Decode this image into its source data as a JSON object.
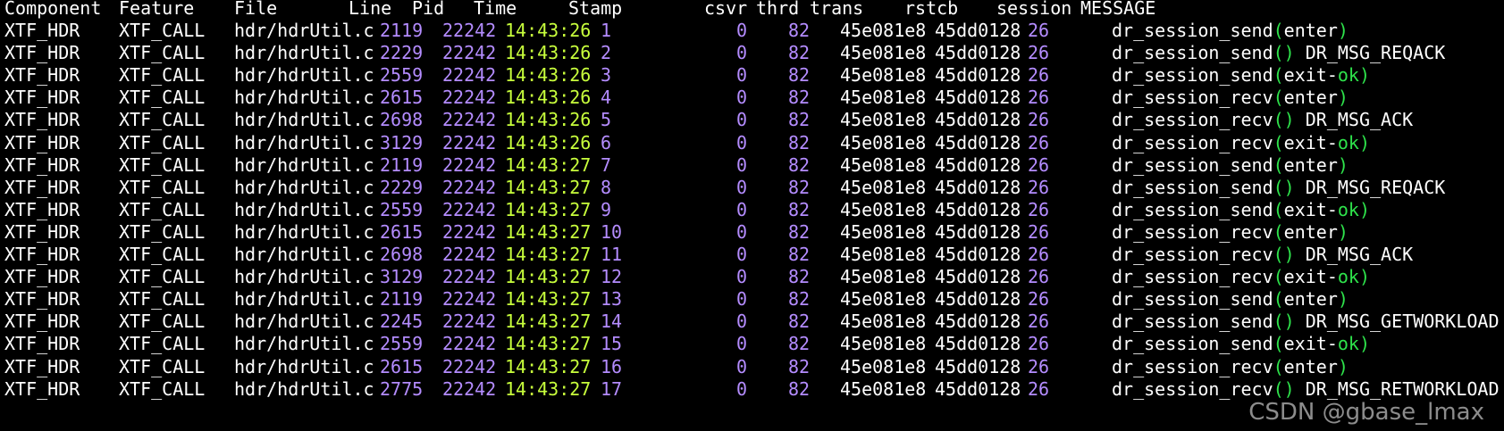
{
  "columns": {
    "component": "Component",
    "feature": "Feature",
    "file": "File",
    "line": "Line",
    "pid": "Pid",
    "time": "Time",
    "stamp": "Stamp",
    "csvr": "csvr",
    "thrd": "thrd",
    "trans": "trans",
    "rstcb": "rstcb",
    "session": "session",
    "message": "MESSAGE"
  },
  "rows": [
    {
      "component": "XTF_HDR",
      "feature": "XTF_CALL",
      "file": "hdr/hdrUtil.c",
      "line": "2119",
      "pid": "22242",
      "time": "14:43:26",
      "stamp": "1",
      "csvr": "0",
      "thrd": "82",
      "trans": "45e081e8",
      "rstcb": "45dd0128",
      "session": "26",
      "func": "dr_session_send",
      "open": "(",
      "arg": "enter",
      "arg_ok": "",
      "close": ")",
      "tail": ""
    },
    {
      "component": "XTF_HDR",
      "feature": "XTF_CALL",
      "file": "hdr/hdrUtil.c",
      "line": "2229",
      "pid": "22242",
      "time": "14:43:26",
      "stamp": "2",
      "csvr": "0",
      "thrd": "82",
      "trans": "45e081e8",
      "rstcb": "45dd0128",
      "session": "26",
      "func": "dr_session_send",
      "open": "(",
      "arg": "",
      "arg_ok": "",
      "close": ")",
      "tail": " DR_MSG_REQACK"
    },
    {
      "component": "XTF_HDR",
      "feature": "XTF_CALL",
      "file": "hdr/hdrUtil.c",
      "line": "2559",
      "pid": "22242",
      "time": "14:43:26",
      "stamp": "3",
      "csvr": "0",
      "thrd": "82",
      "trans": "45e081e8",
      "rstcb": "45dd0128",
      "session": "26",
      "func": "dr_session_send",
      "open": "(",
      "arg": "exit-",
      "arg_ok": "ok",
      "close": ")",
      "tail": ""
    },
    {
      "component": "XTF_HDR",
      "feature": "XTF_CALL",
      "file": "hdr/hdrUtil.c",
      "line": "2615",
      "pid": "22242",
      "time": "14:43:26",
      "stamp": "4",
      "csvr": "0",
      "thrd": "82",
      "trans": "45e081e8",
      "rstcb": "45dd0128",
      "session": "26",
      "func": "dr_session_recv",
      "open": "(",
      "arg": "enter",
      "arg_ok": "",
      "close": ")",
      "tail": ""
    },
    {
      "component": "XTF_HDR",
      "feature": "XTF_CALL",
      "file": "hdr/hdrUtil.c",
      "line": "2698",
      "pid": "22242",
      "time": "14:43:26",
      "stamp": "5",
      "csvr": "0",
      "thrd": "82",
      "trans": "45e081e8",
      "rstcb": "45dd0128",
      "session": "26",
      "func": "dr_session_recv",
      "open": "(",
      "arg": "",
      "arg_ok": "",
      "close": ")",
      "tail": " DR_MSG_ACK"
    },
    {
      "component": "XTF_HDR",
      "feature": "XTF_CALL",
      "file": "hdr/hdrUtil.c",
      "line": "3129",
      "pid": "22242",
      "time": "14:43:26",
      "stamp": "6",
      "csvr": "0",
      "thrd": "82",
      "trans": "45e081e8",
      "rstcb": "45dd0128",
      "session": "26",
      "func": "dr_session_recv",
      "open": "(",
      "arg": "exit-",
      "arg_ok": "ok",
      "close": ")",
      "tail": ""
    },
    {
      "component": "XTF_HDR",
      "feature": "XTF_CALL",
      "file": "hdr/hdrUtil.c",
      "line": "2119",
      "pid": "22242",
      "time": "14:43:27",
      "stamp": "7",
      "csvr": "0",
      "thrd": "82",
      "trans": "45e081e8",
      "rstcb": "45dd0128",
      "session": "26",
      "func": "dr_session_send",
      "open": "(",
      "arg": "enter",
      "arg_ok": "",
      "close": ")",
      "tail": ""
    },
    {
      "component": "XTF_HDR",
      "feature": "XTF_CALL",
      "file": "hdr/hdrUtil.c",
      "line": "2229",
      "pid": "22242",
      "time": "14:43:27",
      "stamp": "8",
      "csvr": "0",
      "thrd": "82",
      "trans": "45e081e8",
      "rstcb": "45dd0128",
      "session": "26",
      "func": "dr_session_send",
      "open": "(",
      "arg": "",
      "arg_ok": "",
      "close": ")",
      "tail": " DR_MSG_REQACK"
    },
    {
      "component": "XTF_HDR",
      "feature": "XTF_CALL",
      "file": "hdr/hdrUtil.c",
      "line": "2559",
      "pid": "22242",
      "time": "14:43:27",
      "stamp": "9",
      "csvr": "0",
      "thrd": "82",
      "trans": "45e081e8",
      "rstcb": "45dd0128",
      "session": "26",
      "func": "dr_session_send",
      "open": "(",
      "arg": "exit-",
      "arg_ok": "ok",
      "close": ")",
      "tail": ""
    },
    {
      "component": "XTF_HDR",
      "feature": "XTF_CALL",
      "file": "hdr/hdrUtil.c",
      "line": "2615",
      "pid": "22242",
      "time": "14:43:27",
      "stamp": "10",
      "csvr": "0",
      "thrd": "82",
      "trans": "45e081e8",
      "rstcb": "45dd0128",
      "session": "26",
      "func": "dr_session_recv",
      "open": "(",
      "arg": "enter",
      "arg_ok": "",
      "close": ")",
      "tail": ""
    },
    {
      "component": "XTF_HDR",
      "feature": "XTF_CALL",
      "file": "hdr/hdrUtil.c",
      "line": "2698",
      "pid": "22242",
      "time": "14:43:27",
      "stamp": "11",
      "csvr": "0",
      "thrd": "82",
      "trans": "45e081e8",
      "rstcb": "45dd0128",
      "session": "26",
      "func": "dr_session_recv",
      "open": "(",
      "arg": "",
      "arg_ok": "",
      "close": ")",
      "tail": " DR_MSG_ACK"
    },
    {
      "component": "XTF_HDR",
      "feature": "XTF_CALL",
      "file": "hdr/hdrUtil.c",
      "line": "3129",
      "pid": "22242",
      "time": "14:43:27",
      "stamp": "12",
      "csvr": "0",
      "thrd": "82",
      "trans": "45e081e8",
      "rstcb": "45dd0128",
      "session": "26",
      "func": "dr_session_recv",
      "open": "(",
      "arg": "exit-",
      "arg_ok": "ok",
      "close": ")",
      "tail": ""
    },
    {
      "component": "XTF_HDR",
      "feature": "XTF_CALL",
      "file": "hdr/hdrUtil.c",
      "line": "2119",
      "pid": "22242",
      "time": "14:43:27",
      "stamp": "13",
      "csvr": "0",
      "thrd": "82",
      "trans": "45e081e8",
      "rstcb": "45dd0128",
      "session": "26",
      "func": "dr_session_send",
      "open": "(",
      "arg": "enter",
      "arg_ok": "",
      "close": ")",
      "tail": ""
    },
    {
      "component": "XTF_HDR",
      "feature": "XTF_CALL",
      "file": "hdr/hdrUtil.c",
      "line": "2245",
      "pid": "22242",
      "time": "14:43:27",
      "stamp": "14",
      "csvr": "0",
      "thrd": "82",
      "trans": "45e081e8",
      "rstcb": "45dd0128",
      "session": "26",
      "func": "dr_session_send",
      "open": "(",
      "arg": "",
      "arg_ok": "",
      "close": ")",
      "tail": " DR_MSG_GETWORKLOAD"
    },
    {
      "component": "XTF_HDR",
      "feature": "XTF_CALL",
      "file": "hdr/hdrUtil.c",
      "line": "2559",
      "pid": "22242",
      "time": "14:43:27",
      "stamp": "15",
      "csvr": "0",
      "thrd": "82",
      "trans": "45e081e8",
      "rstcb": "45dd0128",
      "session": "26",
      "func": "dr_session_send",
      "open": "(",
      "arg": "exit-",
      "arg_ok": "ok",
      "close": ")",
      "tail": ""
    },
    {
      "component": "XTF_HDR",
      "feature": "XTF_CALL",
      "file": "hdr/hdrUtil.c",
      "line": "2615",
      "pid": "22242",
      "time": "14:43:27",
      "stamp": "16",
      "csvr": "0",
      "thrd": "82",
      "trans": "45e081e8",
      "rstcb": "45dd0128",
      "session": "26",
      "func": "dr_session_recv",
      "open": "(",
      "arg": "enter",
      "arg_ok": "",
      "close": ")",
      "tail": ""
    },
    {
      "component": "XTF_HDR",
      "feature": "XTF_CALL",
      "file": "hdr/hdrUtil.c",
      "line": "2775",
      "pid": "22242",
      "time": "14:43:27",
      "stamp": "17",
      "csvr": "0",
      "thrd": "82",
      "trans": "45e081e8",
      "rstcb": "45dd0128",
      "session": "26",
      "func": "dr_session_recv",
      "open": "(",
      "arg": "",
      "arg_ok": "",
      "close": ")",
      "tail": " DR_MSG_RETWORKLOAD"
    }
  ],
  "watermark": "CSDN @gbase_lmax",
  "colors": {
    "background": "#000000",
    "text": "#ffffff",
    "number": "#b48cff",
    "time": "#c8ff3c",
    "paren": "#2ee34b"
  }
}
